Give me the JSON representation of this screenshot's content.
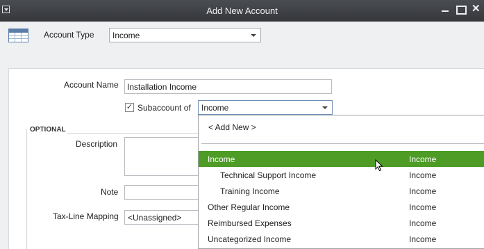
{
  "window": {
    "title": "Add New Account",
    "close_glyph": "✕"
  },
  "form": {
    "account_type_label": "Account Type",
    "account_type_value": "Income",
    "account_name_label": "Account Name",
    "account_name_value": "Installation Income",
    "subaccount_label": "Subaccount of",
    "subaccount_checked": true,
    "subaccount_value": "Income",
    "optional_label": "OPTIONAL",
    "description_label": "Description",
    "note_label": "Note",
    "taxline_label": "Tax-Line Mapping",
    "taxline_value": "<Unassigned>"
  },
  "dropdown": {
    "add_new": "< Add New >",
    "items": [
      {
        "name": "Income",
        "type": "Income",
        "selected": true,
        "indent": false
      },
      {
        "name": "Technical Support Income",
        "type": "Income",
        "selected": false,
        "indent": true
      },
      {
        "name": "Training Income",
        "type": "Income",
        "selected": false,
        "indent": true
      },
      {
        "name": "Other Regular Income",
        "type": "Income",
        "selected": false,
        "indent": false
      },
      {
        "name": "Reimbursed Expenses",
        "type": "Income",
        "selected": false,
        "indent": false
      },
      {
        "name": "Uncategorized Income",
        "type": "Income",
        "selected": false,
        "indent": false
      }
    ]
  },
  "icons": {
    "window_menu": "window-menu-icon",
    "account_type": "accounts-table-icon",
    "checkmark": "✓"
  },
  "colors": {
    "selected_row": "#4e9c26",
    "titlebar": "#3d4044"
  }
}
